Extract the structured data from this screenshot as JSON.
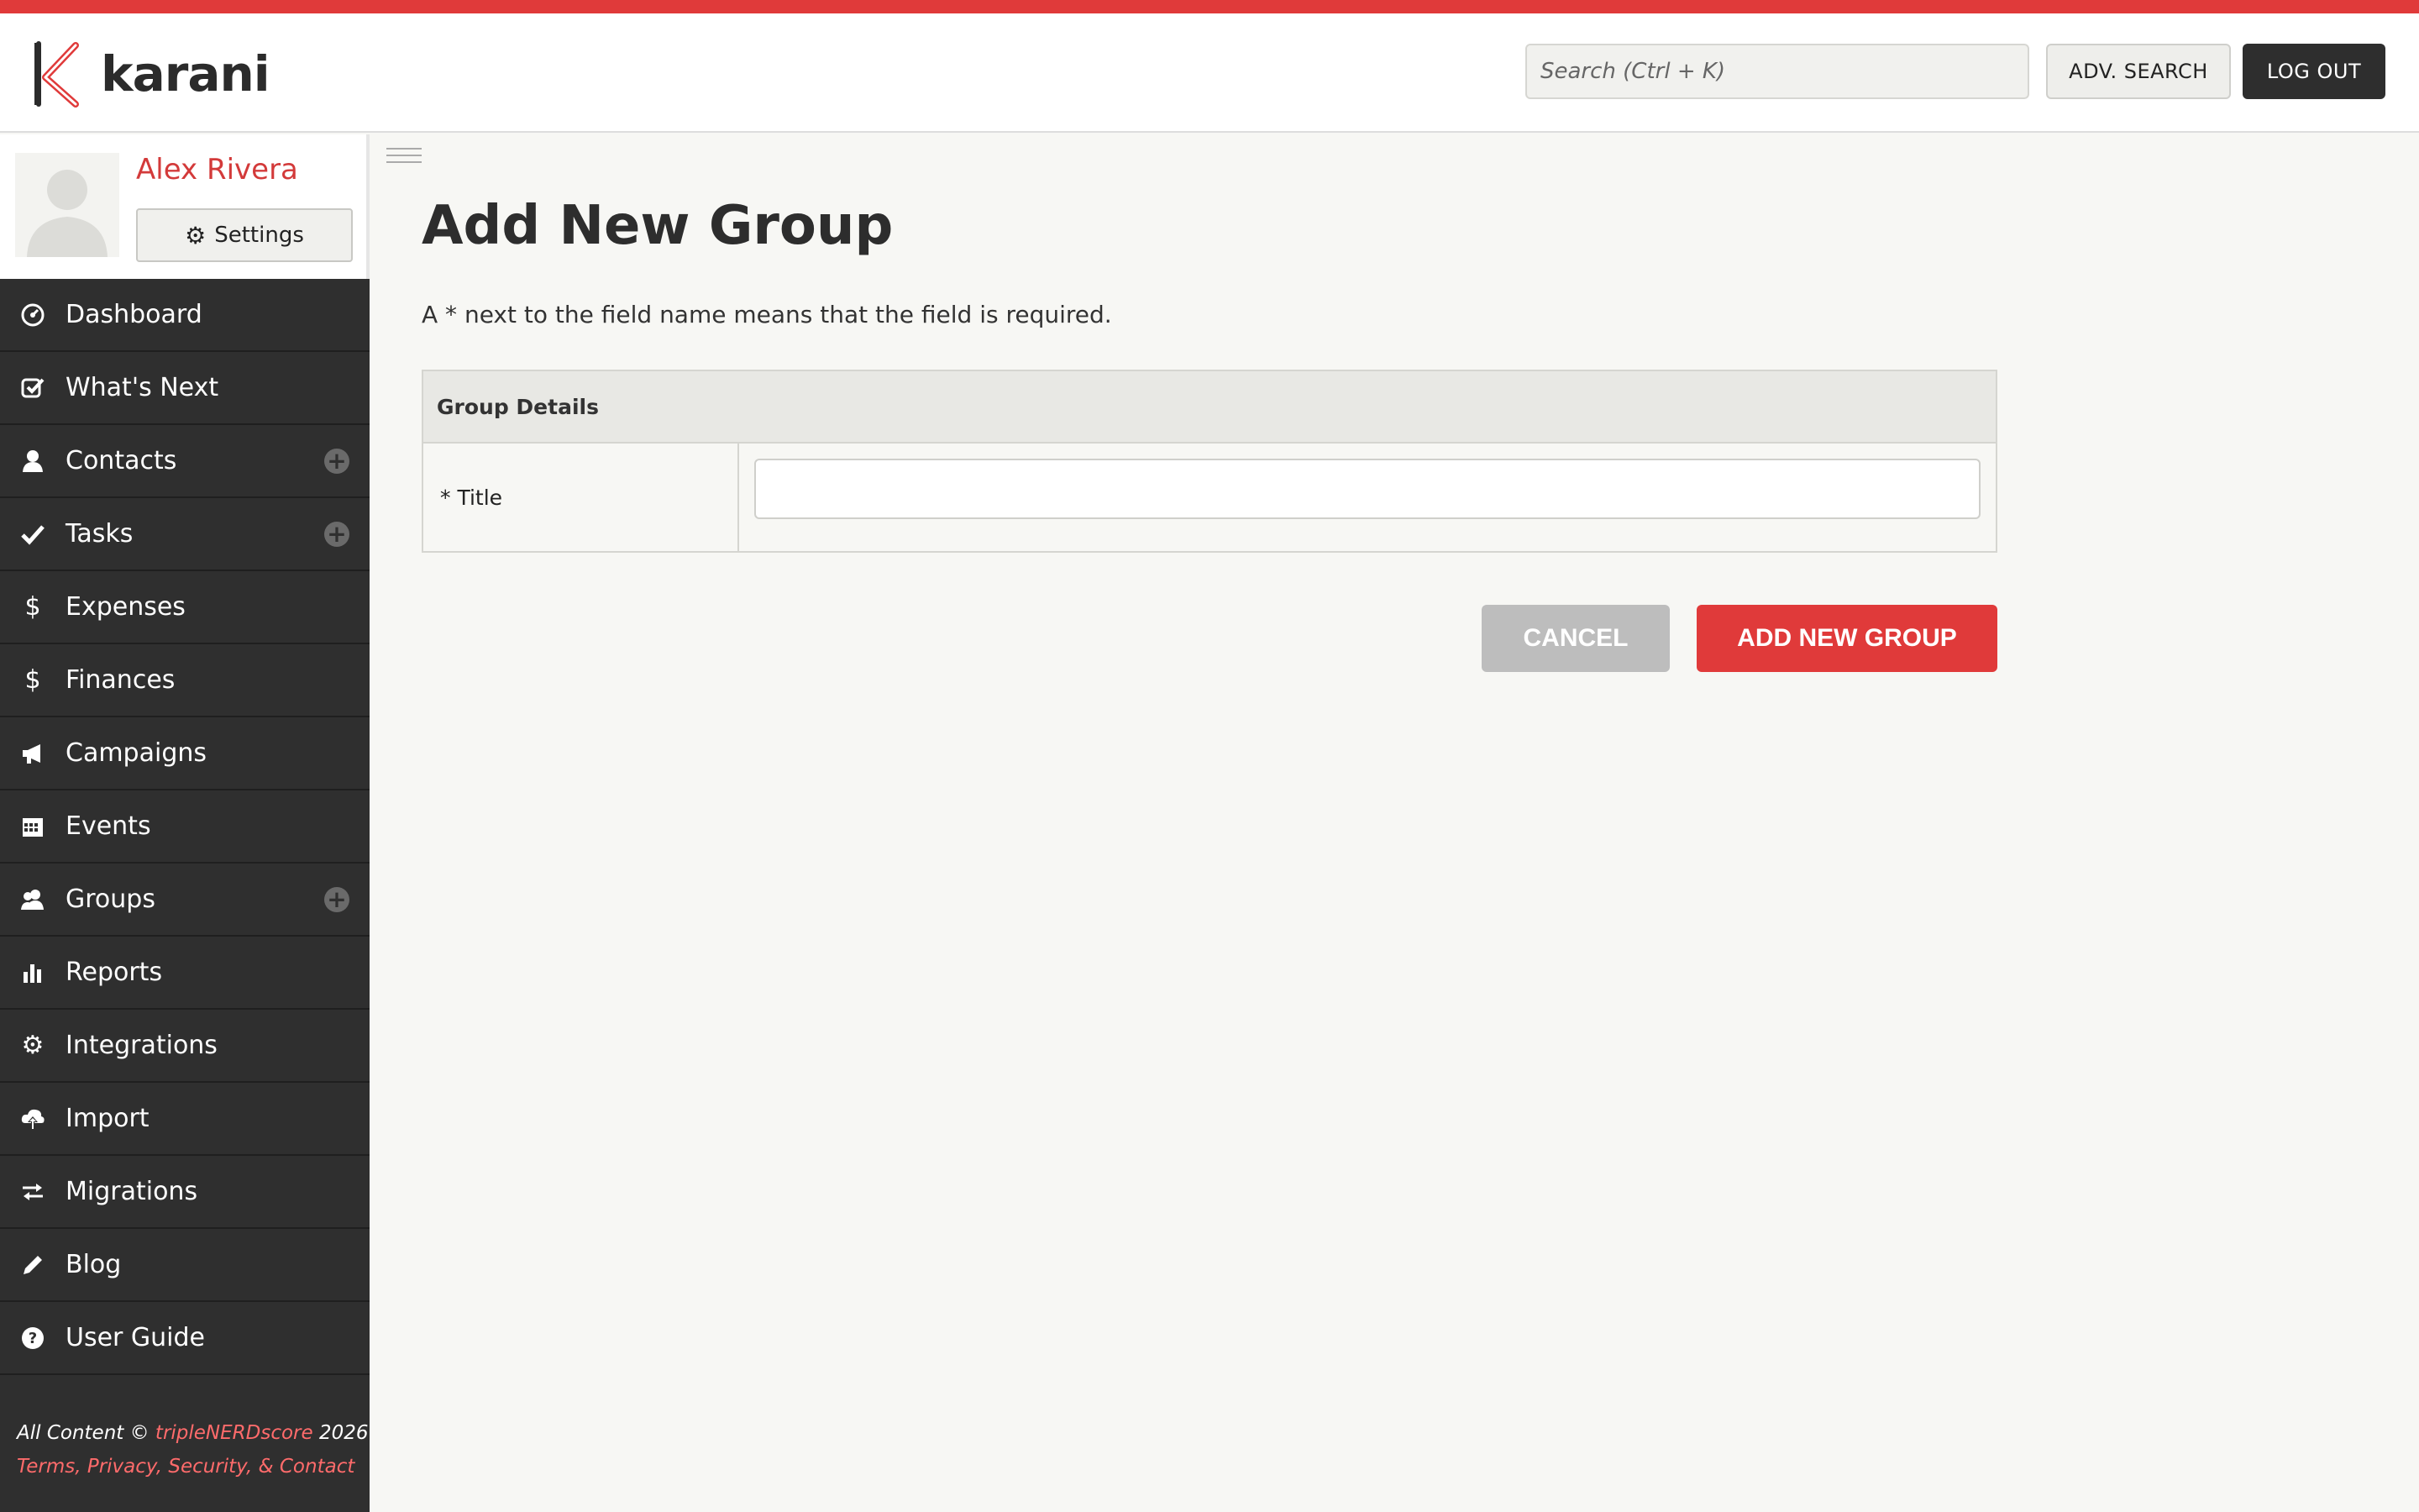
{
  "brand": {
    "name": "karani",
    "accent": "#e03a3a"
  },
  "header": {
    "search_placeholder": "Search (Ctrl + K)",
    "adv_search_label": "ADV. SEARCH",
    "logout_label": "LOG OUT"
  },
  "profile": {
    "name": "Alex Rivera",
    "settings_label": "Settings"
  },
  "sidebar": {
    "items": [
      {
        "label": "Dashboard",
        "icon": "dashboard-icon"
      },
      {
        "label": "What's Next",
        "icon": "checkbox-icon"
      },
      {
        "label": "Contacts",
        "icon": "user-icon",
        "has_add": true
      },
      {
        "label": "Tasks",
        "icon": "check-icon",
        "has_add": true
      },
      {
        "label": "Expenses",
        "icon": "dollar-icon"
      },
      {
        "label": "Finances",
        "icon": "dollar-icon"
      },
      {
        "label": "Campaigns",
        "icon": "megaphone-icon"
      },
      {
        "label": "Events",
        "icon": "calendar-icon"
      },
      {
        "label": "Groups",
        "icon": "group-icon",
        "has_add": true
      },
      {
        "label": "Reports",
        "icon": "bar-chart-icon"
      },
      {
        "label": "Integrations",
        "icon": "gear-icon"
      },
      {
        "label": "Import",
        "icon": "cloud-upload-icon"
      },
      {
        "label": "Migrations",
        "icon": "arrows-icon"
      },
      {
        "label": "Blog",
        "icon": "pencil-icon"
      },
      {
        "label": "User Guide",
        "icon": "question-icon"
      }
    ],
    "add_symbol": "+"
  },
  "footer": {
    "prefix": "All Content © ",
    "org": "tripleNERDscore",
    "year": " 2026",
    "links": "Terms, Privacy, Security, & Contact"
  },
  "main": {
    "title": "Add New Group",
    "required_note": "A * next to the field name means that the field is required.",
    "section_header": "Group Details",
    "fields": [
      {
        "label": "* Title",
        "value": ""
      }
    ],
    "cancel_label": "CANCEL",
    "submit_label": "ADD NEW GROUP"
  }
}
